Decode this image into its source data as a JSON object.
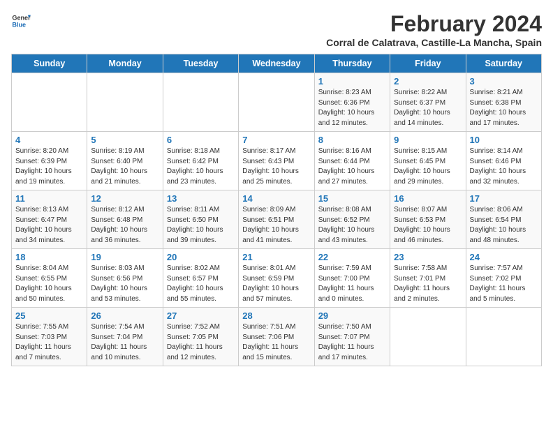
{
  "header": {
    "logo_general": "General",
    "logo_blue": "Blue",
    "month_year": "February 2024",
    "location": "Corral de Calatrava, Castille-La Mancha, Spain"
  },
  "days_of_week": [
    "Sunday",
    "Monday",
    "Tuesday",
    "Wednesday",
    "Thursday",
    "Friday",
    "Saturday"
  ],
  "weeks": [
    [
      {
        "day": "",
        "info": ""
      },
      {
        "day": "",
        "info": ""
      },
      {
        "day": "",
        "info": ""
      },
      {
        "day": "",
        "info": ""
      },
      {
        "day": "1",
        "info": "Sunrise: 8:23 AM\nSunset: 6:36 PM\nDaylight: 10 hours\nand 12 minutes."
      },
      {
        "day": "2",
        "info": "Sunrise: 8:22 AM\nSunset: 6:37 PM\nDaylight: 10 hours\nand 14 minutes."
      },
      {
        "day": "3",
        "info": "Sunrise: 8:21 AM\nSunset: 6:38 PM\nDaylight: 10 hours\nand 17 minutes."
      }
    ],
    [
      {
        "day": "4",
        "info": "Sunrise: 8:20 AM\nSunset: 6:39 PM\nDaylight: 10 hours\nand 19 minutes."
      },
      {
        "day": "5",
        "info": "Sunrise: 8:19 AM\nSunset: 6:40 PM\nDaylight: 10 hours\nand 21 minutes."
      },
      {
        "day": "6",
        "info": "Sunrise: 8:18 AM\nSunset: 6:42 PM\nDaylight: 10 hours\nand 23 minutes."
      },
      {
        "day": "7",
        "info": "Sunrise: 8:17 AM\nSunset: 6:43 PM\nDaylight: 10 hours\nand 25 minutes."
      },
      {
        "day": "8",
        "info": "Sunrise: 8:16 AM\nSunset: 6:44 PM\nDaylight: 10 hours\nand 27 minutes."
      },
      {
        "day": "9",
        "info": "Sunrise: 8:15 AM\nSunset: 6:45 PM\nDaylight: 10 hours\nand 29 minutes."
      },
      {
        "day": "10",
        "info": "Sunrise: 8:14 AM\nSunset: 6:46 PM\nDaylight: 10 hours\nand 32 minutes."
      }
    ],
    [
      {
        "day": "11",
        "info": "Sunrise: 8:13 AM\nSunset: 6:47 PM\nDaylight: 10 hours\nand 34 minutes."
      },
      {
        "day": "12",
        "info": "Sunrise: 8:12 AM\nSunset: 6:48 PM\nDaylight: 10 hours\nand 36 minutes."
      },
      {
        "day": "13",
        "info": "Sunrise: 8:11 AM\nSunset: 6:50 PM\nDaylight: 10 hours\nand 39 minutes."
      },
      {
        "day": "14",
        "info": "Sunrise: 8:09 AM\nSunset: 6:51 PM\nDaylight: 10 hours\nand 41 minutes."
      },
      {
        "day": "15",
        "info": "Sunrise: 8:08 AM\nSunset: 6:52 PM\nDaylight: 10 hours\nand 43 minutes."
      },
      {
        "day": "16",
        "info": "Sunrise: 8:07 AM\nSunset: 6:53 PM\nDaylight: 10 hours\nand 46 minutes."
      },
      {
        "day": "17",
        "info": "Sunrise: 8:06 AM\nSunset: 6:54 PM\nDaylight: 10 hours\nand 48 minutes."
      }
    ],
    [
      {
        "day": "18",
        "info": "Sunrise: 8:04 AM\nSunset: 6:55 PM\nDaylight: 10 hours\nand 50 minutes."
      },
      {
        "day": "19",
        "info": "Sunrise: 8:03 AM\nSunset: 6:56 PM\nDaylight: 10 hours\nand 53 minutes."
      },
      {
        "day": "20",
        "info": "Sunrise: 8:02 AM\nSunset: 6:57 PM\nDaylight: 10 hours\nand 55 minutes."
      },
      {
        "day": "21",
        "info": "Sunrise: 8:01 AM\nSunset: 6:59 PM\nDaylight: 10 hours\nand 57 minutes."
      },
      {
        "day": "22",
        "info": "Sunrise: 7:59 AM\nSunset: 7:00 PM\nDaylight: 11 hours\nand 0 minutes."
      },
      {
        "day": "23",
        "info": "Sunrise: 7:58 AM\nSunset: 7:01 PM\nDaylight: 11 hours\nand 2 minutes."
      },
      {
        "day": "24",
        "info": "Sunrise: 7:57 AM\nSunset: 7:02 PM\nDaylight: 11 hours\nand 5 minutes."
      }
    ],
    [
      {
        "day": "25",
        "info": "Sunrise: 7:55 AM\nSunset: 7:03 PM\nDaylight: 11 hours\nand 7 minutes."
      },
      {
        "day": "26",
        "info": "Sunrise: 7:54 AM\nSunset: 7:04 PM\nDaylight: 11 hours\nand 10 minutes."
      },
      {
        "day": "27",
        "info": "Sunrise: 7:52 AM\nSunset: 7:05 PM\nDaylight: 11 hours\nand 12 minutes."
      },
      {
        "day": "28",
        "info": "Sunrise: 7:51 AM\nSunset: 7:06 PM\nDaylight: 11 hours\nand 15 minutes."
      },
      {
        "day": "29",
        "info": "Sunrise: 7:50 AM\nSunset: 7:07 PM\nDaylight: 11 hours\nand 17 minutes."
      },
      {
        "day": "",
        "info": ""
      },
      {
        "day": "",
        "info": ""
      }
    ]
  ]
}
